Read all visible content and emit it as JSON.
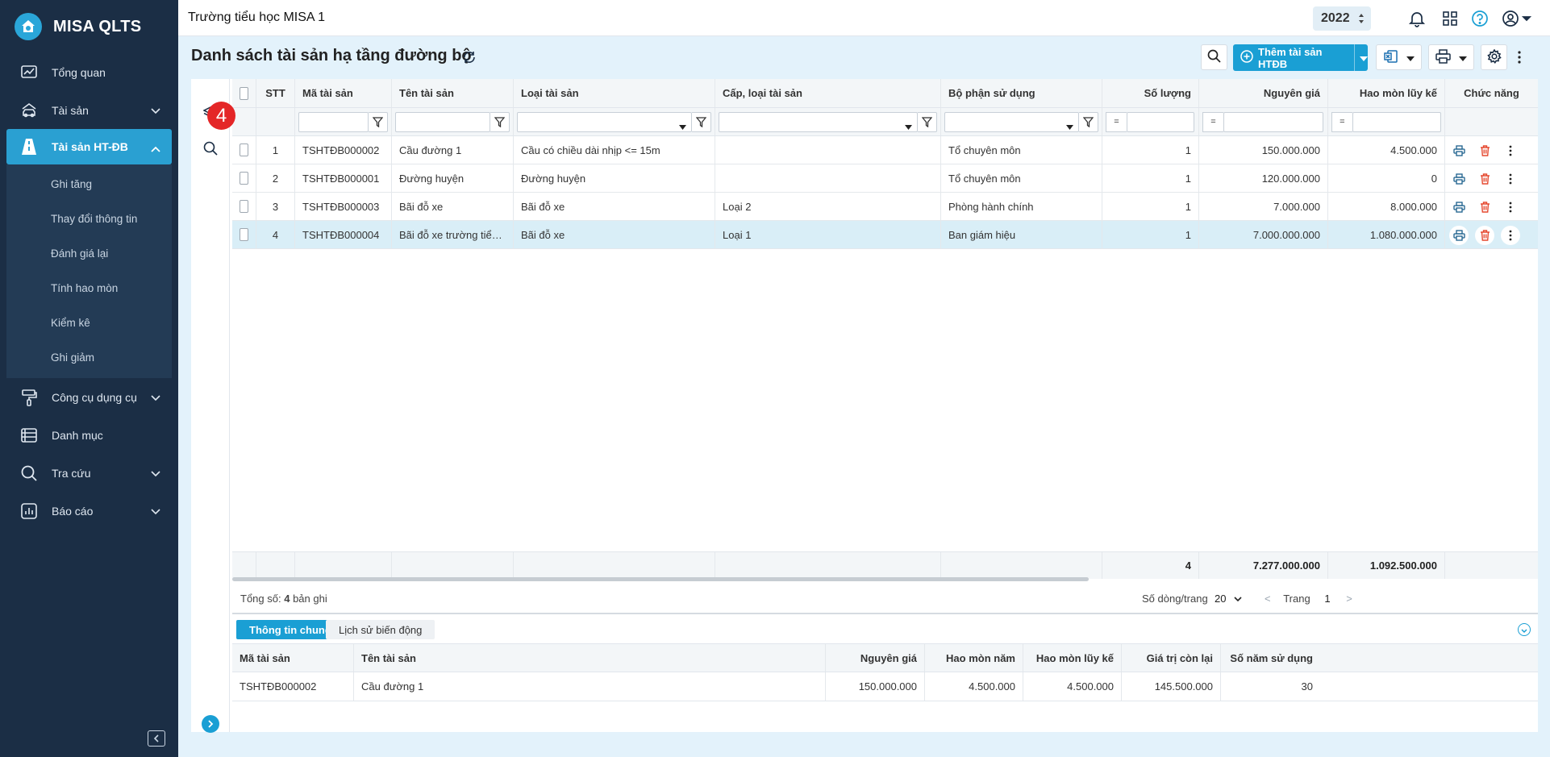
{
  "app": {
    "name": "MISA QLTS",
    "org_name": "Trường tiểu học MISA 1",
    "year": "2022"
  },
  "colors": {
    "sidebar": "#1b2e45",
    "accent": "#1a9fd4",
    "badge": "#e42627",
    "selected_row": "#d9eef7",
    "delete_icon": "#e5482f"
  },
  "sidebar": {
    "items": [
      {
        "label": "Tổng quan",
        "icon": "chart-icon"
      },
      {
        "label": "Tài sản",
        "icon": "car-house-icon"
      },
      {
        "label": "Tài sản HT-ĐB",
        "icon": "road-icon"
      },
      {
        "label": "Công cụ dụng cụ",
        "icon": "paint-roller-icon"
      },
      {
        "label": "Danh mục",
        "icon": "list-icon"
      },
      {
        "label": "Tra cứu",
        "icon": "search-icon"
      },
      {
        "label": "Báo cáo",
        "icon": "report-icon"
      }
    ],
    "submenu": [
      "Ghi tăng",
      "Thay đổi thông tin",
      "Đánh giá lại",
      "Tính hao mòn",
      "Kiểm kê",
      "Ghi giảm"
    ]
  },
  "page": {
    "title": "Danh sách tài sản hạ tầng đường bộ",
    "add_label": "Thêm tài sản HTĐB",
    "badge": "4"
  },
  "grid": {
    "columns": [
      "STT",
      "Mã tài sản",
      "Tên tài sản",
      "Loại tài sản",
      "Cấp, loại tài sản",
      "Bộ phận sử dụng",
      "Số lượng",
      "Nguyên giá",
      "Hao mòn lũy kế",
      "Chức năng"
    ],
    "filter_eq": "=",
    "rows": [
      {
        "stt": "1",
        "code": "TSHTĐB000002",
        "name": "Cầu đường 1",
        "type": "Cầu có chiều dài nhịp <= 15m",
        "level": "",
        "dept": "Tổ chuyên môn",
        "qty": "1",
        "cost": "150.000.000",
        "depr": "4.500.000"
      },
      {
        "stt": "2",
        "code": "TSHTĐB000001",
        "name": "Đường huyện",
        "type": "Đường huyện",
        "level": "",
        "dept": "Tổ chuyên môn",
        "qty": "1",
        "cost": "120.000.000",
        "depr": "0"
      },
      {
        "stt": "3",
        "code": "TSHTĐB000003",
        "name": "Bãi đỗ xe",
        "type": "Bãi đỗ xe",
        "level": "Loại 2",
        "dept": "Phòng hành chính",
        "qty": "1",
        "cost": "7.000.000",
        "depr": "8.000.000"
      },
      {
        "stt": "4",
        "code": "TSHTĐB000004",
        "name": "Bãi đỗ xe trường tiểu học",
        "type": "Bãi đỗ xe",
        "level": "Loại 1",
        "dept": "Ban giám hiệu",
        "qty": "1",
        "cost": "7.000.000.000",
        "depr": "1.080.000.000"
      }
    ],
    "totals": {
      "qty": "4",
      "cost": "7.277.000.000",
      "depr": "1.092.500.000"
    }
  },
  "pager": {
    "total_prefix": "Tổng số:",
    "total_count": "4",
    "total_suffix": "bản ghi",
    "rows_label": "Số dòng/trang",
    "rows_value": "20",
    "page_label": "Trang",
    "page_value": "1"
  },
  "detail": {
    "tabs": [
      "Thông tin chung",
      "Lịch sử biến động"
    ],
    "columns": [
      "Mã tài sản",
      "Tên tài sản",
      "Nguyên giá",
      "Hao mòn năm",
      "Hao mòn lũy kế",
      "Giá trị còn lại",
      "Số năm sử dụng"
    ],
    "row": [
      "TSHTĐB000002",
      "Cầu đường 1",
      "150.000.000",
      "4.500.000",
      "4.500.000",
      "145.500.000",
      "30"
    ]
  }
}
